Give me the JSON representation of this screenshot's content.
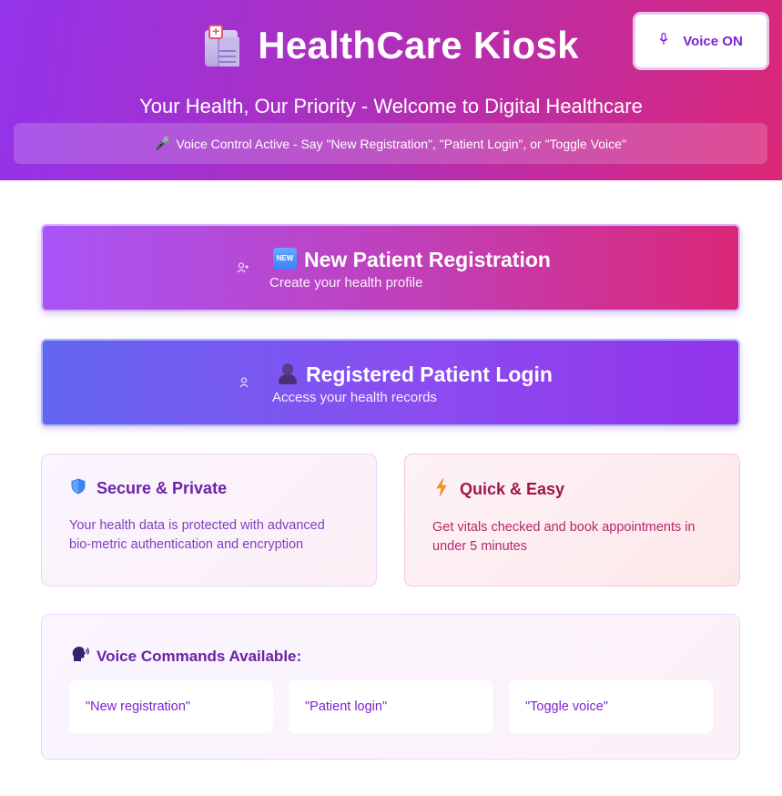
{
  "header": {
    "title": "HealthCare Kiosk",
    "logo_icon": "hospital-icon",
    "subtitle": "Your Health, Our Priority - Welcome to Digital Healthcare",
    "voice_button": {
      "label": "Voice ON",
      "icon": "microphone-icon"
    },
    "voice_banner": {
      "icon": "microphone-icon",
      "text": "Voice Control Active - Say \"New Registration\", \"Patient Login\", or \"Toggle Voice\""
    }
  },
  "actions": {
    "registration": {
      "badge_text": "NEW",
      "label": "New Patient Registration",
      "subtitle": "Create your health profile",
      "icon": "user-plus-icon"
    },
    "login": {
      "label": "Registered Patient Login",
      "subtitle": "Access your health records",
      "icon": "user-icon"
    }
  },
  "cards": {
    "secure": {
      "icon": "shield-icon",
      "title": "Secure & Private",
      "text": "Your health data is protected with advanced bio-metric authentication and encryption"
    },
    "quick": {
      "icon": "lightning-icon",
      "title": "Quick & Easy",
      "text": "Get vitals checked and book appointments in under 5 minutes"
    }
  },
  "commands": {
    "icon": "speaking-head-icon",
    "title": "Voice Commands Available:",
    "items": [
      "\"New registration\"",
      "\"Patient login\"",
      "\"Toggle voice\""
    ]
  },
  "colors": {
    "header_start": "#9333ea",
    "header_end": "#db2777",
    "accent_purple": "#7e22ce",
    "login_start": "#6366f1"
  }
}
